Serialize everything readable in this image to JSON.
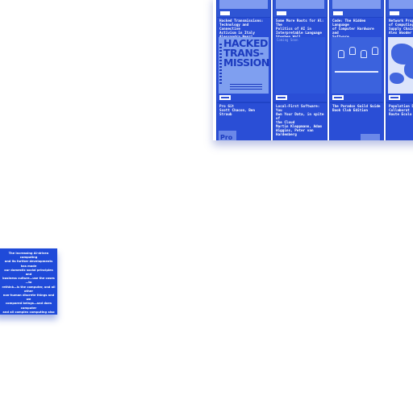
{
  "catalog": {
    "cards": [
      {
        "title": "Hacked Transmissions:\nTechnology and Connective\nActivism in Italy\nAlessandra Renzi",
        "cover_title": "HACKED\nTRANS-\nMISSIONS",
        "cover_style": "hacked"
      },
      {
        "title": "Some More Roots for Al: The\nPolitics of AI in\nInterpretable Language\nStephen Wall",
        "cover_hint": "Coming Soon",
        "cover_style": "blank"
      },
      {
        "title": "Code: The Hidden Language\nof Computer Hardware and\nSoftware\nCharles Petzold",
        "cover_style": "figures"
      },
      {
        "title": "Network Prop\nof Computing\nSupply Chain\nAlex Wooder",
        "cover_style": "map"
      }
    ],
    "row2": [
      {
        "title": "Pro Git\nScott Chacon, Ben Straub",
        "thumb_text": "Pro"
      },
      {
        "title": "Local-First Software: You\nOwn Your Data, in spite of\nthe Cloud\nMartin Kleppmann, Adam\nWiggins, Peter van\nHardenberg",
        "thumb_text": ""
      },
      {
        "title": "The Paradox Guild Guide\nBook Club Edition",
        "thumb_text": ""
      },
      {
        "title": "Population D\nCollaborat\nRoute Ecolo",
        "thumb_text": ""
      }
    ]
  },
  "backcover": {
    "blurb": "The increasing AI-driven computing\nand its further developments has made\nour domestic social principles and\nbusiness culture—use the cases—to\nrethink—is the computer, and all other\nnon-human discrete things and we\ncompared beings—and does computer\nand all complex computing also\nthe human culture?"
  },
  "colors": {
    "card_blue": "#2a4ed6",
    "cover_blue": "#5d7de6",
    "backcover_blue": "#1f4ad9"
  }
}
